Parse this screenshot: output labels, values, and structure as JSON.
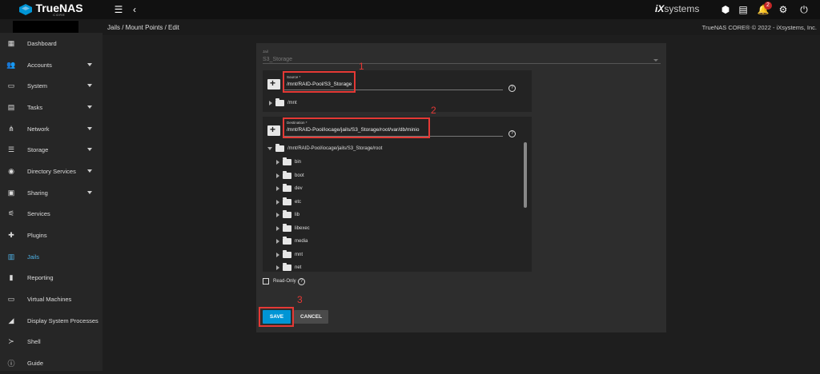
{
  "topbar": {
    "logo_text": "TrueNAS",
    "logo_sub": "CORE",
    "brand_mark": "iX",
    "brand_rest": "systems",
    "notification_count": "2",
    "icons": [
      "menu-icon",
      "back-icon",
      "truecommand-icon",
      "tasks-icon",
      "notifications-icon",
      "settings-icon",
      "power-icon"
    ]
  },
  "breadcrumb": "Jails  /  Mount Points  /  Edit",
  "copyright": "TrueNAS CORE® © 2022 - iXsystems, Inc.",
  "sidebar": {
    "items": [
      {
        "label": "Dashboard",
        "icon": "dashboard-icon",
        "glyph": "▦"
      },
      {
        "label": "Accounts",
        "icon": "accounts-icon",
        "glyph": "👥",
        "expand": true
      },
      {
        "label": "System",
        "icon": "system-icon",
        "glyph": "▭",
        "expand": true
      },
      {
        "label": "Tasks",
        "icon": "tasks-icon",
        "glyph": "▤",
        "expand": true
      },
      {
        "label": "Network",
        "icon": "network-icon",
        "glyph": "⋔",
        "expand": true
      },
      {
        "label": "Storage",
        "icon": "storage-icon",
        "glyph": "☰",
        "expand": true
      },
      {
        "label": "Directory Services",
        "icon": "directory-services-icon",
        "glyph": "◉",
        "expand": true
      },
      {
        "label": "Sharing",
        "icon": "sharing-icon",
        "glyph": "▣",
        "expand": true
      },
      {
        "label": "Services",
        "icon": "services-icon",
        "glyph": "⚟"
      },
      {
        "label": "Plugins",
        "icon": "plugins-icon",
        "glyph": "✚"
      },
      {
        "label": "Jails",
        "icon": "jails-icon",
        "glyph": "▥",
        "active": true
      },
      {
        "label": "Reporting",
        "icon": "reporting-icon",
        "glyph": "▮"
      },
      {
        "label": "Virtual Machines",
        "icon": "virtual-machines-icon",
        "glyph": "▭"
      },
      {
        "label": "Display System Processes",
        "icon": "processes-icon",
        "glyph": "◢"
      },
      {
        "label": "Shell",
        "icon": "shell-icon",
        "glyph": "≻"
      },
      {
        "label": "Guide",
        "icon": "guide-icon",
        "glyph": "ⓘ"
      }
    ]
  },
  "form": {
    "jail_label": "Jail",
    "jail_value": "S3_Storage",
    "source_label": "Source *",
    "source_value": "/mnt/RAID-Pool/S3_Storage",
    "source_tree_root": "/mnt",
    "destination_label": "Destination *",
    "destination_value": "/mnt/RAID-Pool/iocage/jails/S3_Storage/root/var/db/minio",
    "destination_tree_root": "/mnt/RAID-Pool/iocage/jails/S3_Storage/root",
    "destination_tree_children": [
      "bin",
      "boot",
      "dev",
      "etc",
      "lib",
      "libexec",
      "media",
      "mnt",
      "net"
    ],
    "read_only_label": "Read-Only",
    "save_label": "SAVE",
    "cancel_label": "CANCEL"
  },
  "annotations": [
    "1",
    "2",
    "3"
  ],
  "colors": {
    "accent": "#0095d5",
    "annotation": "#e53935",
    "active_nav": "#4fb3e8"
  }
}
